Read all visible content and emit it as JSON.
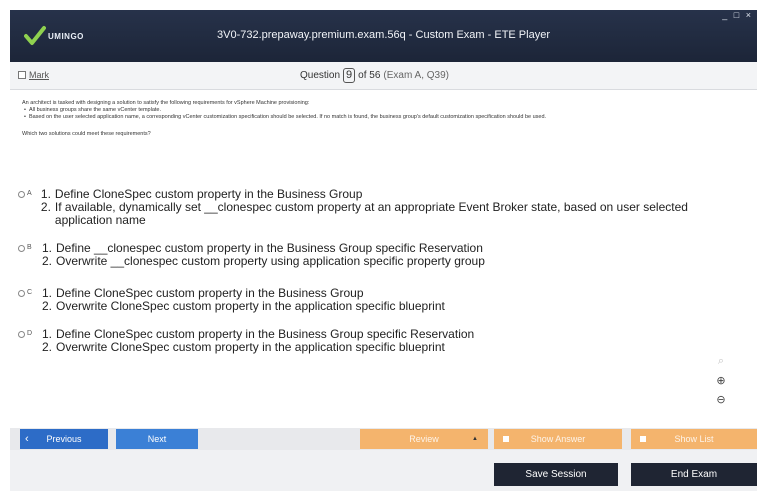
{
  "window": {
    "logo_text": "UMINGO",
    "title": "3V0-732.prepaway.premium.exam.56q - Custom Exam - ETE Player",
    "controls": "_ □ ×"
  },
  "header": {
    "mark_label": "Mark",
    "question_label": "Question",
    "question_number": "9",
    "question_total": "of 56",
    "question_ref": "(Exam A, Q39)"
  },
  "question": {
    "intro": "An architect is tasked with designing a solution to satisfy the following requirements for vSphere Machine provisioning:",
    "requirements": [
      "All business groups share the same vCenter template.",
      "Based on the user selected application name, a corresponding vCenter customization specification should be selected. If no match is found, the business group's default customization specification should be used."
    ],
    "prompt": "Which two solutions could meet these requirements?"
  },
  "options": [
    {
      "letter": "A",
      "steps": [
        {
          "num": "1.",
          "text": "Define CloneSpec custom property in the Business Group"
        },
        {
          "num": "2.",
          "text": "If available, dynamically set __clonespec custom property at an appropriate Event Broker state, based on user selected application name"
        }
      ]
    },
    {
      "letter": "B",
      "steps": [
        {
          "num": "1.",
          "text": "Define __clonespec custom property in the Business Group specific Reservation"
        },
        {
          "num": "2.",
          "text": "Overwrite __clonespec custom property using application specific property group"
        }
      ]
    },
    {
      "letter": "C",
      "steps": [
        {
          "num": "1.",
          "text": "Define CloneSpec custom property in the Business Group"
        },
        {
          "num": "2.",
          "text": "Overwrite CloneSpec custom property in the application specific blueprint"
        }
      ]
    },
    {
      "letter": "D",
      "steps": [
        {
          "num": "1.",
          "text": "Define CloneSpec custom property in the Business Group specific Reservation"
        },
        {
          "num": "2.",
          "text": "Overwrite CloneSpec custom property in the application specific blueprint"
        }
      ]
    }
  ],
  "tools": {
    "search_icon": "⌕",
    "zoom_in_icon": "⊕",
    "zoom_out_icon": "⊖"
  },
  "nav": {
    "previous_label": "Previous",
    "next_label": "Next",
    "review_label": "Review",
    "show_answer_label": "Show Answer",
    "show_list_label": "Show List",
    "save_session_label": "Save Session",
    "end_exam_label": "End Exam"
  },
  "colors": {
    "titlebar": "#1c2538",
    "nav_blue": "#2d6cc7",
    "nav_orange": "#f4b46d",
    "footer_button": "#1f2533"
  }
}
